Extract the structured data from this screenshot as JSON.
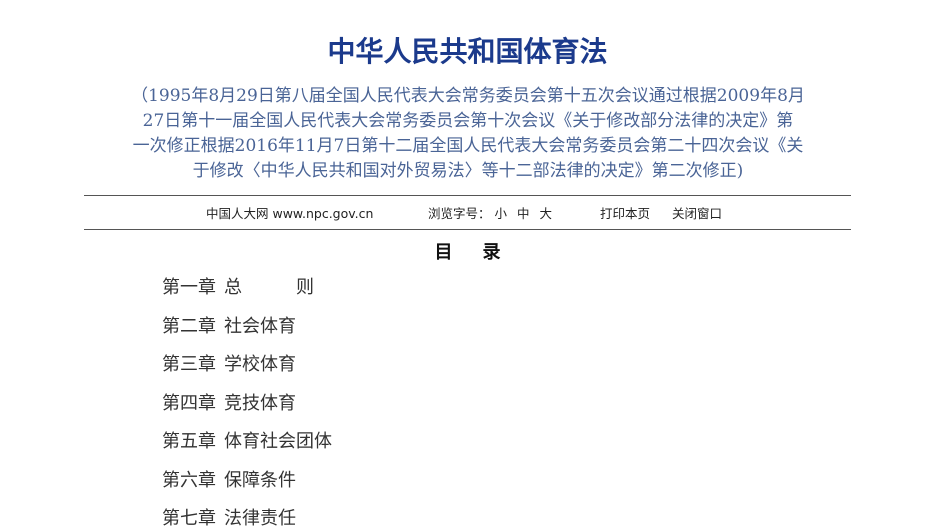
{
  "title": "中华人民共和国体育法",
  "subtitle_lines": [
    "（1995年8月29日第八届全国人民代表大会常务委员会第十五次会议通过根据2009年8月",
    "27日第十一届全国人民代表大会常务委员会第十次会议《关于修改部分法律的决定》第",
    "一次修正根据2016年11月7日第十二届全国人民代表大会常务委员会第二十四次会议《关",
    "于修改〈中华人民共和国对外贸易法〉等十二部法律的决定》第二次修正)"
  ],
  "toolbar": {
    "site": "中国人大网 www.npc.gov.cn",
    "font_size_label": "浏览字号：",
    "font_small": "小",
    "font_medium": "中",
    "font_large": "大",
    "print": "打印本页",
    "close": "关闭窗口"
  },
  "toc": {
    "heading": "目录",
    "items": [
      {
        "chapter": "第一章",
        "name": "总　　　则"
      },
      {
        "chapter": "第二章",
        "name": "社会体育"
      },
      {
        "chapter": "第三章",
        "name": "学校体育"
      },
      {
        "chapter": "第四章",
        "name": "竞技体育"
      },
      {
        "chapter": "第五章",
        "name": "体育社会团体"
      },
      {
        "chapter": "第六章",
        "name": "保障条件"
      },
      {
        "chapter": "第七章",
        "name": "法律责任"
      }
    ]
  }
}
